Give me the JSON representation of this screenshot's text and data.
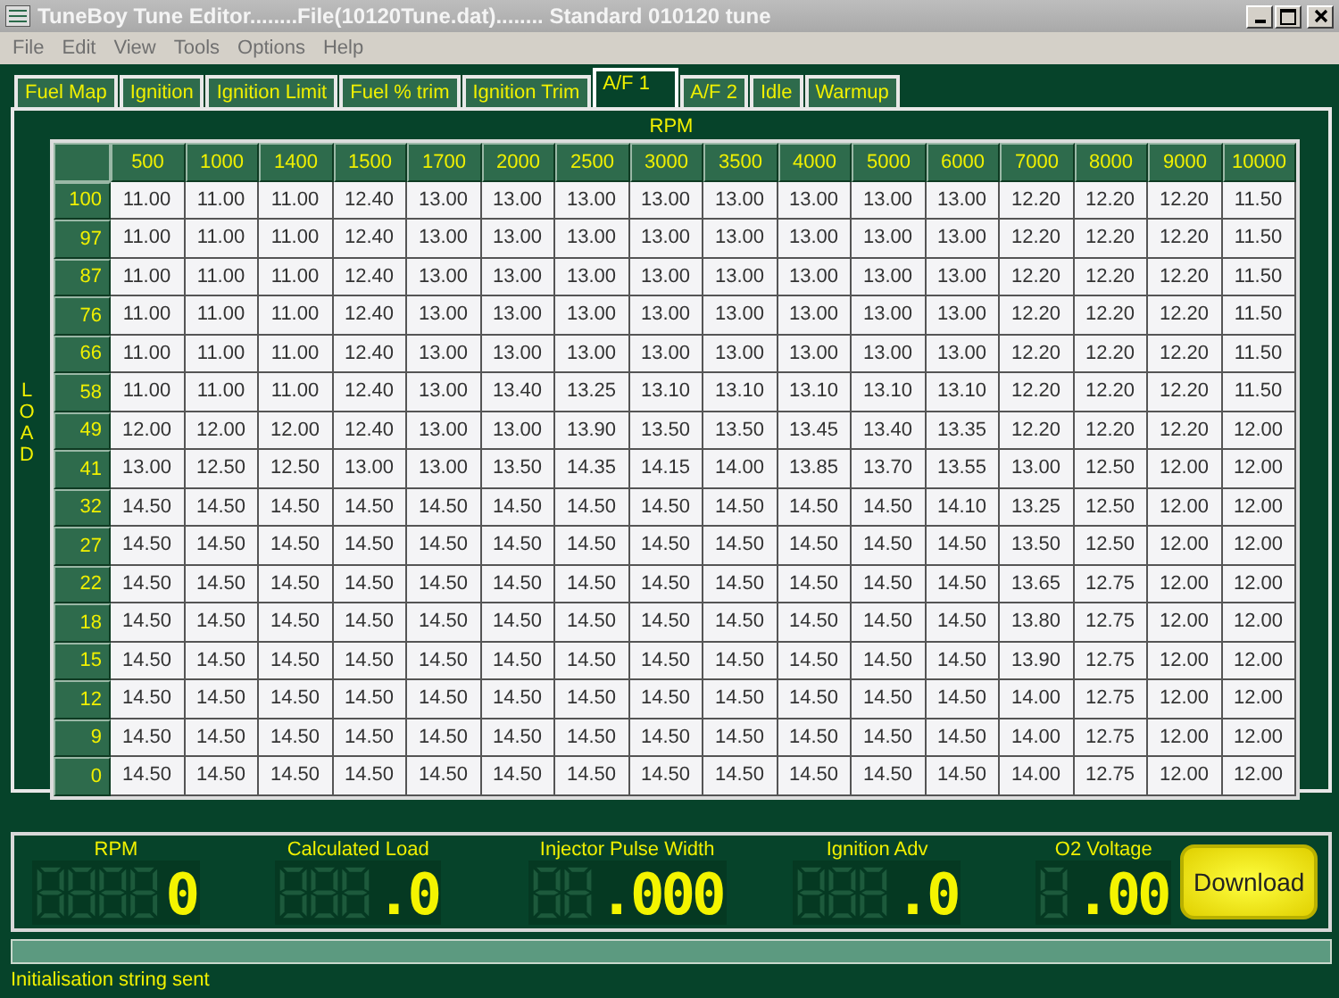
{
  "window": {
    "title": "TuneBoy Tune Editor........File(10120Tune.dat)........ Standard 010120 tune"
  },
  "menu": [
    "File",
    "Edit",
    "View",
    "Tools",
    "Options",
    "Help"
  ],
  "tabs": [
    {
      "label": "Fuel Map",
      "selected": false
    },
    {
      "label": "Ignition",
      "selected": false
    },
    {
      "label": "Ignition Limit",
      "selected": false
    },
    {
      "label": "Fuel % trim",
      "selected": false
    },
    {
      "label": "Ignition Trim",
      "selected": false
    },
    {
      "label": "A/F 1",
      "selected": true
    },
    {
      "label": "A/F 2",
      "selected": false
    },
    {
      "label": "Idle",
      "selected": false
    },
    {
      "label": "Warmup",
      "selected": false
    }
  ],
  "table": {
    "column_axis": "RPM",
    "row_axis": "LOAD",
    "columns": [
      "500",
      "1000",
      "1400",
      "1500",
      "1700",
      "2000",
      "2500",
      "3000",
      "3500",
      "4000",
      "5000",
      "6000",
      "7000",
      "8000",
      "9000",
      "10000"
    ],
    "rows": [
      {
        "load": "100",
        "cells": [
          "11.00",
          "11.00",
          "11.00",
          "12.40",
          "13.00",
          "13.00",
          "13.00",
          "13.00",
          "13.00",
          "13.00",
          "13.00",
          "13.00",
          "12.20",
          "12.20",
          "12.20",
          "11.50"
        ]
      },
      {
        "load": "97",
        "cells": [
          "11.00",
          "11.00",
          "11.00",
          "12.40",
          "13.00",
          "13.00",
          "13.00",
          "13.00",
          "13.00",
          "13.00",
          "13.00",
          "13.00",
          "12.20",
          "12.20",
          "12.20",
          "11.50"
        ]
      },
      {
        "load": "87",
        "cells": [
          "11.00",
          "11.00",
          "11.00",
          "12.40",
          "13.00",
          "13.00",
          "13.00",
          "13.00",
          "13.00",
          "13.00",
          "13.00",
          "13.00",
          "12.20",
          "12.20",
          "12.20",
          "11.50"
        ]
      },
      {
        "load": "76",
        "cells": [
          "11.00",
          "11.00",
          "11.00",
          "12.40",
          "13.00",
          "13.00",
          "13.00",
          "13.00",
          "13.00",
          "13.00",
          "13.00",
          "13.00",
          "12.20",
          "12.20",
          "12.20",
          "11.50"
        ]
      },
      {
        "load": "66",
        "cells": [
          "11.00",
          "11.00",
          "11.00",
          "12.40",
          "13.00",
          "13.00",
          "13.00",
          "13.00",
          "13.00",
          "13.00",
          "13.00",
          "13.00",
          "12.20",
          "12.20",
          "12.20",
          "11.50"
        ]
      },
      {
        "load": "58",
        "cells": [
          "11.00",
          "11.00",
          "11.00",
          "12.40",
          "13.00",
          "13.40",
          "13.25",
          "13.10",
          "13.10",
          "13.10",
          "13.10",
          "13.10",
          "12.20",
          "12.20",
          "12.20",
          "11.50"
        ]
      },
      {
        "load": "49",
        "cells": [
          "12.00",
          "12.00",
          "12.00",
          "12.40",
          "13.00",
          "13.00",
          "13.90",
          "13.50",
          "13.50",
          "13.45",
          "13.40",
          "13.35",
          "12.20",
          "12.20",
          "12.20",
          "12.00"
        ]
      },
      {
        "load": "41",
        "cells": [
          "13.00",
          "12.50",
          "12.50",
          "13.00",
          "13.00",
          "13.50",
          "14.35",
          "14.15",
          "14.00",
          "13.85",
          "13.70",
          "13.55",
          "13.00",
          "12.50",
          "12.00",
          "12.00"
        ]
      },
      {
        "load": "32",
        "cells": [
          "14.50",
          "14.50",
          "14.50",
          "14.50",
          "14.50",
          "14.50",
          "14.50",
          "14.50",
          "14.50",
          "14.50",
          "14.50",
          "14.10",
          "13.25",
          "12.50",
          "12.00",
          "12.00"
        ]
      },
      {
        "load": "27",
        "cells": [
          "14.50",
          "14.50",
          "14.50",
          "14.50",
          "14.50",
          "14.50",
          "14.50",
          "14.50",
          "14.50",
          "14.50",
          "14.50",
          "14.50",
          "13.50",
          "12.50",
          "12.00",
          "12.00"
        ]
      },
      {
        "load": "22",
        "cells": [
          "14.50",
          "14.50",
          "14.50",
          "14.50",
          "14.50",
          "14.50",
          "14.50",
          "14.50",
          "14.50",
          "14.50",
          "14.50",
          "14.50",
          "13.65",
          "12.75",
          "12.00",
          "12.00"
        ]
      },
      {
        "load": "18",
        "cells": [
          "14.50",
          "14.50",
          "14.50",
          "14.50",
          "14.50",
          "14.50",
          "14.50",
          "14.50",
          "14.50",
          "14.50",
          "14.50",
          "14.50",
          "13.80",
          "12.75",
          "12.00",
          "12.00"
        ]
      },
      {
        "load": "15",
        "cells": [
          "14.50",
          "14.50",
          "14.50",
          "14.50",
          "14.50",
          "14.50",
          "14.50",
          "14.50",
          "14.50",
          "14.50",
          "14.50",
          "14.50",
          "13.90",
          "12.75",
          "12.00",
          "12.00"
        ]
      },
      {
        "load": "12",
        "cells": [
          "14.50",
          "14.50",
          "14.50",
          "14.50",
          "14.50",
          "14.50",
          "14.50",
          "14.50",
          "14.50",
          "14.50",
          "14.50",
          "14.50",
          "14.00",
          "12.75",
          "12.00",
          "12.00"
        ]
      },
      {
        "load": "9",
        "cells": [
          "14.50",
          "14.50",
          "14.50",
          "14.50",
          "14.50",
          "14.50",
          "14.50",
          "14.50",
          "14.50",
          "14.50",
          "14.50",
          "14.50",
          "14.00",
          "12.75",
          "12.00",
          "12.00"
        ]
      },
      {
        "load": "0",
        "cells": [
          "14.50",
          "14.50",
          "14.50",
          "14.50",
          "14.50",
          "14.50",
          "14.50",
          "14.50",
          "14.50",
          "14.50",
          "14.50",
          "14.50",
          "14.00",
          "12.75",
          "12.00",
          "12.00"
        ]
      }
    ]
  },
  "gauges": [
    {
      "label": "RPM",
      "value": "0"
    },
    {
      "label": "Calculated Load",
      "value": ".0"
    },
    {
      "label": "Injector Pulse Width",
      "value": ".000"
    },
    {
      "label": "Ignition Adv",
      "value": ".0"
    },
    {
      "label": "O2 Voltage",
      "value": ".00"
    }
  ],
  "download_button": "Download",
  "progress": {
    "level": 0
  },
  "status_bar": "Initialisation string sent"
}
